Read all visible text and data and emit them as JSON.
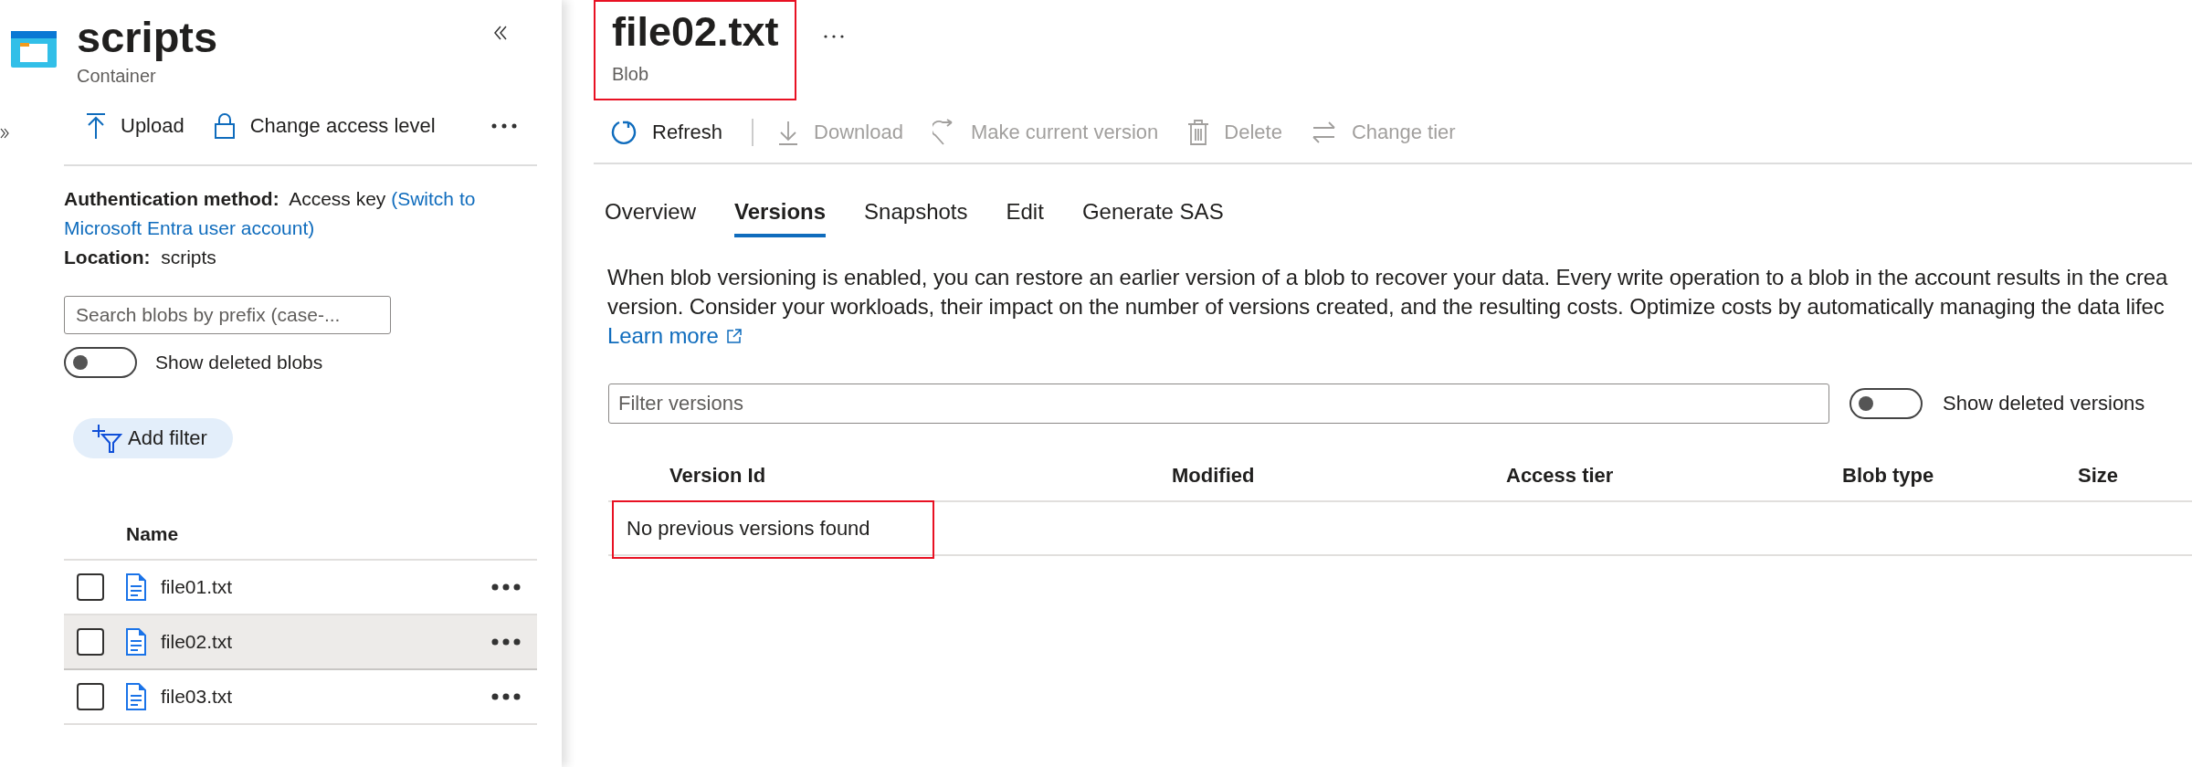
{
  "container": {
    "title": "scripts",
    "subtitle": "Container"
  },
  "container_toolbar": [
    {
      "kind": "upload",
      "label": "Upload"
    },
    {
      "kind": "lock",
      "label": "Change access level"
    }
  ],
  "auth": {
    "label": "Authentication method:",
    "value": "Access key",
    "link": [
      "(Switch to",
      "Microsoft Entra user account)"
    ]
  },
  "location": {
    "label": "Location:",
    "value": "scripts"
  },
  "search": {
    "placeholder": "Search blobs by prefix (case-..."
  },
  "show_deleted_blobs": {
    "label": "Show deleted blobs",
    "on": false
  },
  "add_filter": {
    "label": "Add filter"
  },
  "blob_list": {
    "columns": [
      "Name"
    ],
    "rows": [
      {
        "name": "file01.txt",
        "checked": false,
        "selected": false
      },
      {
        "name": "file02.txt",
        "checked": false,
        "selected": true
      },
      {
        "name": "file03.txt",
        "checked": false,
        "selected": false
      }
    ]
  },
  "blob": {
    "title": "file02.txt",
    "subtitle": "Blob",
    "highlighted": true
  },
  "blob_toolbar": [
    {
      "kind": "refresh",
      "label": "Refresh",
      "disabled": false
    },
    {
      "kind": "download",
      "label": "Download",
      "disabled": true
    },
    {
      "kind": "restore",
      "label": "Make current version",
      "disabled": true
    },
    {
      "kind": "delete",
      "label": "Delete",
      "disabled": true
    },
    {
      "kind": "tier",
      "label": "Change tier",
      "disabled": true
    }
  ],
  "tabs": [
    {
      "label": "Overview",
      "selected": false
    },
    {
      "label": "Versions",
      "selected": true
    },
    {
      "label": "Snapshots",
      "selected": false
    },
    {
      "label": "Edit",
      "selected": false
    },
    {
      "label": "Generate SAS",
      "selected": false
    }
  ],
  "description": [
    "When blob versioning is enabled, you can restore an earlier version of a blob to recover your data. Every write operation to a blob in the account results in the crea",
    "version. Consider your workloads, their impact on the number of versions created, and the resulting costs. Optimize costs by automatically managing the data lifec"
  ],
  "learn_more": "Learn more",
  "filter": {
    "placeholder": "Filter versions"
  },
  "show_deleted_versions": {
    "label": "Show deleted versions",
    "on": false
  },
  "versions_table": {
    "columns": [
      "Version Id",
      "Modified",
      "Access tier",
      "Blob type",
      "Size"
    ],
    "empty_message": "No previous versions found",
    "highlighted": true
  }
}
